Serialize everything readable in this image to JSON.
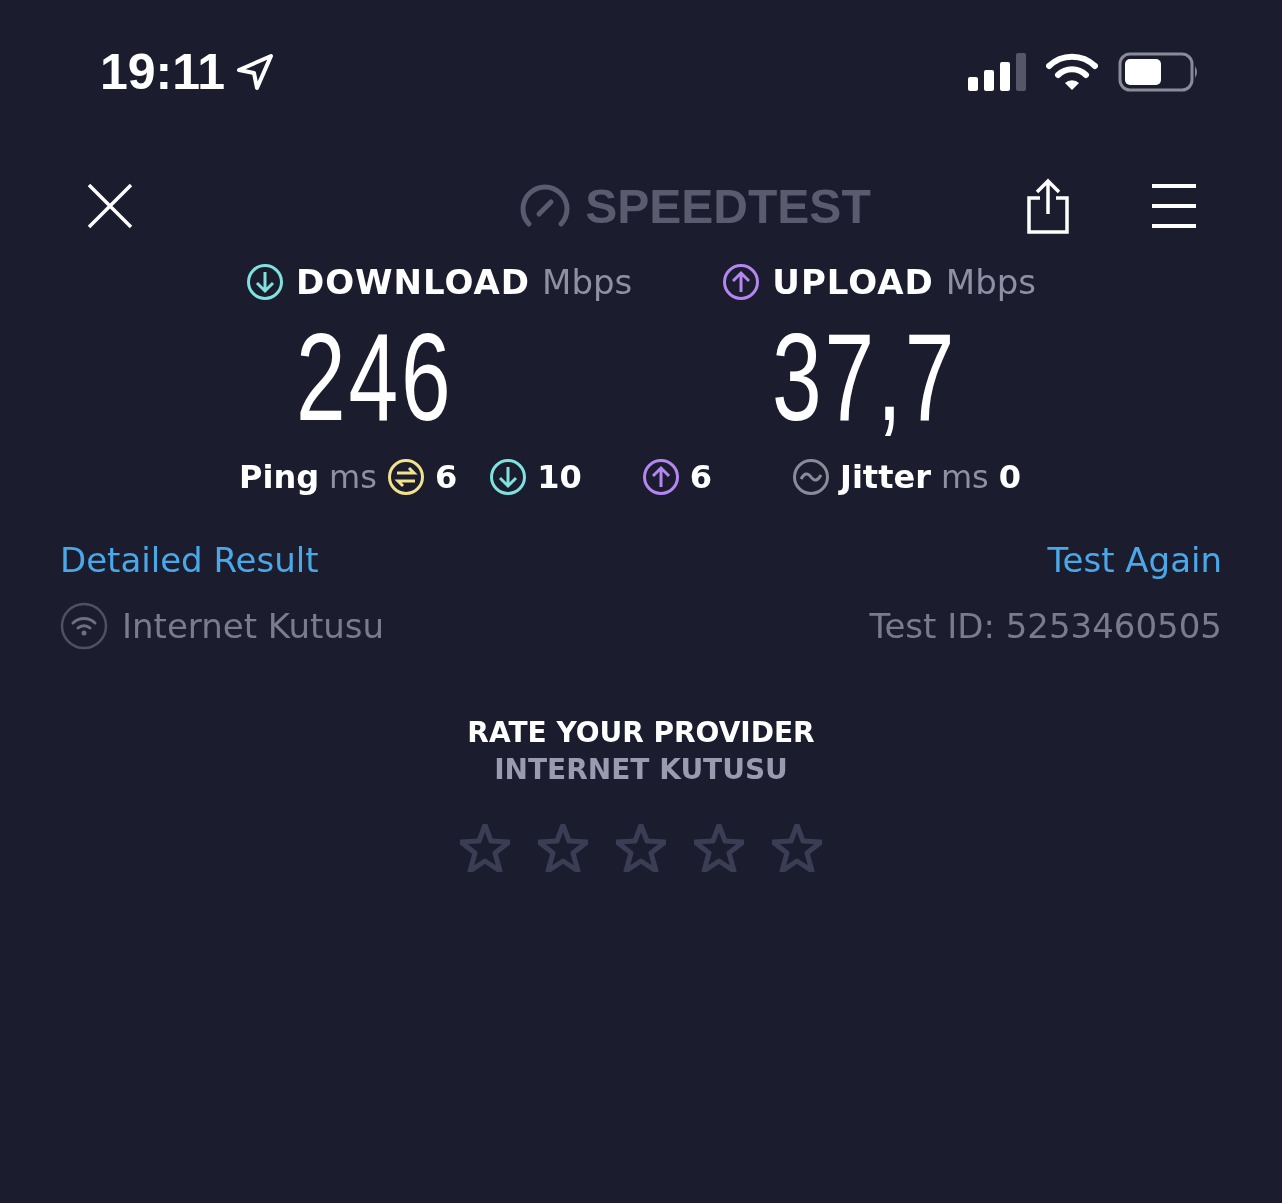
{
  "status_bar": {
    "time": "19:11"
  },
  "header": {
    "logo": "SPEEDTEST"
  },
  "results": [
    {
      "kind": "download",
      "label": "DOWNLOAD",
      "unit": "Mbps",
      "value": "246"
    },
    {
      "kind": "upload",
      "label": "UPLOAD",
      "unit": "Mbps",
      "value": "37,7"
    }
  ],
  "ping": {
    "label": "Ping",
    "unit": "ms",
    "items": [
      {
        "kind": "idle",
        "value": "6"
      },
      {
        "kind": "download",
        "value": "10"
      },
      {
        "kind": "upload",
        "value": "6"
      }
    ]
  },
  "jitter": {
    "label": "Jitter",
    "unit": "ms",
    "value": "0"
  },
  "links": {
    "detailed": "Detailed Result",
    "again": "Test Again"
  },
  "network": {
    "name": "Internet Kutusu",
    "test_id": "Test ID: 5253460505"
  },
  "rating": {
    "title": "RATE YOUR PROVIDER",
    "provider": "INTERNET KUTUSU",
    "stars": 0
  }
}
